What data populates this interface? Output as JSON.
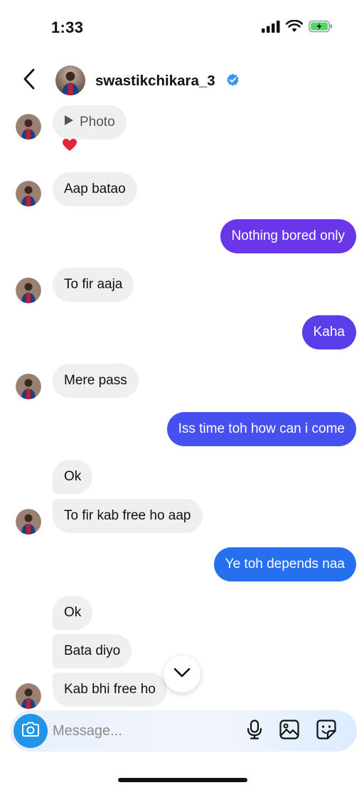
{
  "status_bar": {
    "time": "1:33",
    "battery_color": "#4cd964"
  },
  "header": {
    "username": "swastikchikara_3",
    "verified_color": "#1d9bf0"
  },
  "theme": {
    "incoming_bg": "#efefef",
    "accent": "#2196e8"
  },
  "messages": [
    {
      "dir": "in",
      "text": "Photo",
      "type": "photo",
      "reaction": "❤️"
    },
    {
      "dir": "in",
      "text": "Aap batao"
    },
    {
      "dir": "out",
      "text": "Nothing bored only"
    },
    {
      "dir": "in",
      "text": "To fir aaja"
    },
    {
      "dir": "out",
      "text": "Kaha"
    },
    {
      "dir": "in",
      "text": "Mere pass"
    },
    {
      "dir": "out",
      "text": "Iss time toh how can i come"
    },
    {
      "dir": "in",
      "text": "Ok"
    },
    {
      "dir": "in",
      "text": "To fir kab free ho aap"
    },
    {
      "dir": "out",
      "text": "Ye toh depends naa"
    },
    {
      "dir": "in",
      "text": "Ok"
    },
    {
      "dir": "in",
      "text": "Bata diyo"
    },
    {
      "dir": "in",
      "text": "Kab bhi free ho"
    }
  ],
  "composer": {
    "placeholder": "Message..."
  },
  "icons": [
    "back-icon",
    "verified-icon",
    "play-icon",
    "chevron-down-icon",
    "camera-icon",
    "microphone-icon",
    "gallery-icon",
    "sticker-icon",
    "signal-icon",
    "wifi-icon",
    "battery-icon"
  ]
}
